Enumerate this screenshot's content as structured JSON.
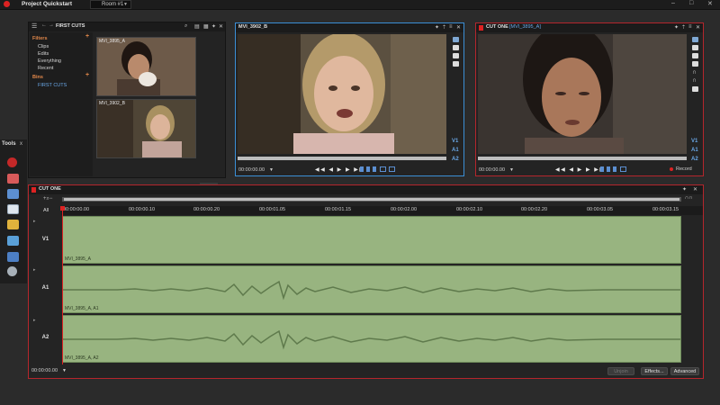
{
  "app": {
    "project_title": "Project Quickstart",
    "room": "Room #1",
    "window_controls": [
      "–",
      "□",
      "✕"
    ]
  },
  "bins_panel": {
    "title": "FIRST CUTS",
    "filters_header": "Filters",
    "filters": [
      "Clips",
      "Edits",
      "Everything",
      "Recent"
    ],
    "bins_header": "Bins",
    "bins": [
      "FIRST CUTS"
    ],
    "clips": [
      {
        "name": "MVI_3895_A"
      },
      {
        "name": "MVI_3902_B"
      }
    ]
  },
  "source_viewer": {
    "title": "MVI_3902_B",
    "timecode": "00:00:00.00",
    "tracks": [
      "V1",
      "A1",
      "A2"
    ],
    "transport": "◀◀ ◀ ▶ ▶ ▶▶"
  },
  "record_viewer": {
    "title": "CUT ONE",
    "clip_name": "[MVI_3895_A]",
    "timecode": "00:00:00.00",
    "tracks": [
      "V1",
      "A1",
      "A2"
    ],
    "transport": "◀◀ ◀ ▶ ▶ ▶▶",
    "record_label": "Record"
  },
  "tools": {
    "title": "Tools"
  },
  "timeline": {
    "title": "CUT ONE",
    "all_label": "All",
    "ruler_ticks": [
      "00:00:00.00",
      "00:00:00.10",
      "00:00:00.20",
      "00:00:01.05",
      "00:00:01.15",
      "00:00:02.00",
      "00:00:02.10",
      "00:00:02.20",
      "00:00:03.05",
      "00:00:03.15"
    ],
    "tracks": [
      {
        "label": "V1",
        "clip": "MVI_3895_A"
      },
      {
        "label": "A1",
        "clip": "MVI_3895_A, A1"
      },
      {
        "label": "A2",
        "clip": "MVI_3895_A, A2"
      }
    ],
    "timecode": "00:00:00.00",
    "buttons": {
      "unjoin": "Unjoin",
      "effects": "Effects...",
      "advanced": "Advanced"
    }
  },
  "colors": {
    "accent_blue": "#3b8fd6",
    "record_red": "#b5262c",
    "track_green": "#98b480",
    "filter_orange": "#e0874a"
  }
}
